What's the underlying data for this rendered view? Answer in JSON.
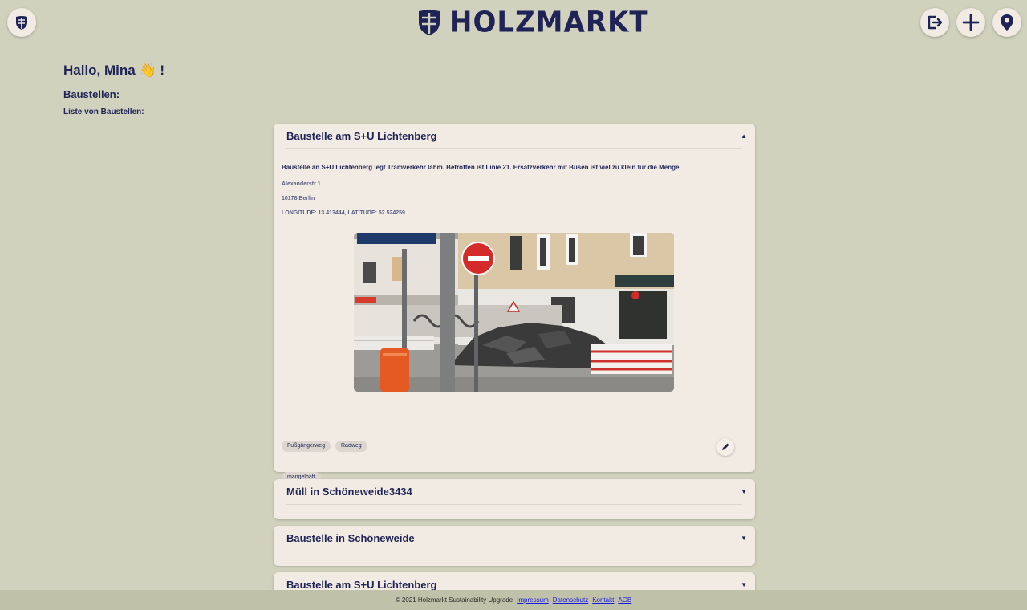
{
  "header": {
    "logo_text": "HOLZMARKT",
    "home_icon": "holzmarkt-shield-icon",
    "logout_icon": "logout-icon",
    "add_icon": "plus-icon",
    "map_icon": "map-pin-icon"
  },
  "greeting": "Hallo, Mina 👋 !",
  "section_title": "Baustellen:",
  "list_title": "Liste von Baustellen:",
  "cards": [
    {
      "title": "Baustelle am S+U Lichtenberg",
      "expanded": true,
      "caret": "▲",
      "description": "Baustelle an S+U Lichtenberg legt Tramverkehr lahm. Betroffen ist Linie 21. Ersatzverkehr mit Busen ist viel zu klein für die Menge",
      "street": "Alexanderstr 1",
      "city": "10178 Berlin",
      "coords": "LONGITUDE: 13.413444, LATITUDE: 52.524259",
      "categories": [
        "Fußgängerweg",
        "Radweg"
      ],
      "status": "mangelhaft",
      "edit_icon": "pencil-icon"
    },
    {
      "title": "Müll in Schöneweide3434",
      "expanded": false,
      "caret": "▼"
    },
    {
      "title": "Baustelle in Schöneweide",
      "expanded": false,
      "caret": "▼"
    },
    {
      "title": "Baustelle am S+U Lichtenberg",
      "expanded": false,
      "caret": "▼"
    }
  ],
  "footer": {
    "copyright": "© 2021 Holzmarkt Sustainability Upgrade",
    "links": [
      "Impressum",
      "Datenschutz",
      "Kontakt",
      "AGB"
    ]
  },
  "colors": {
    "background": "#d0d2bd",
    "card": "#f2ebe4",
    "brand": "#1f2356",
    "footer": "#bfc1a8"
  }
}
